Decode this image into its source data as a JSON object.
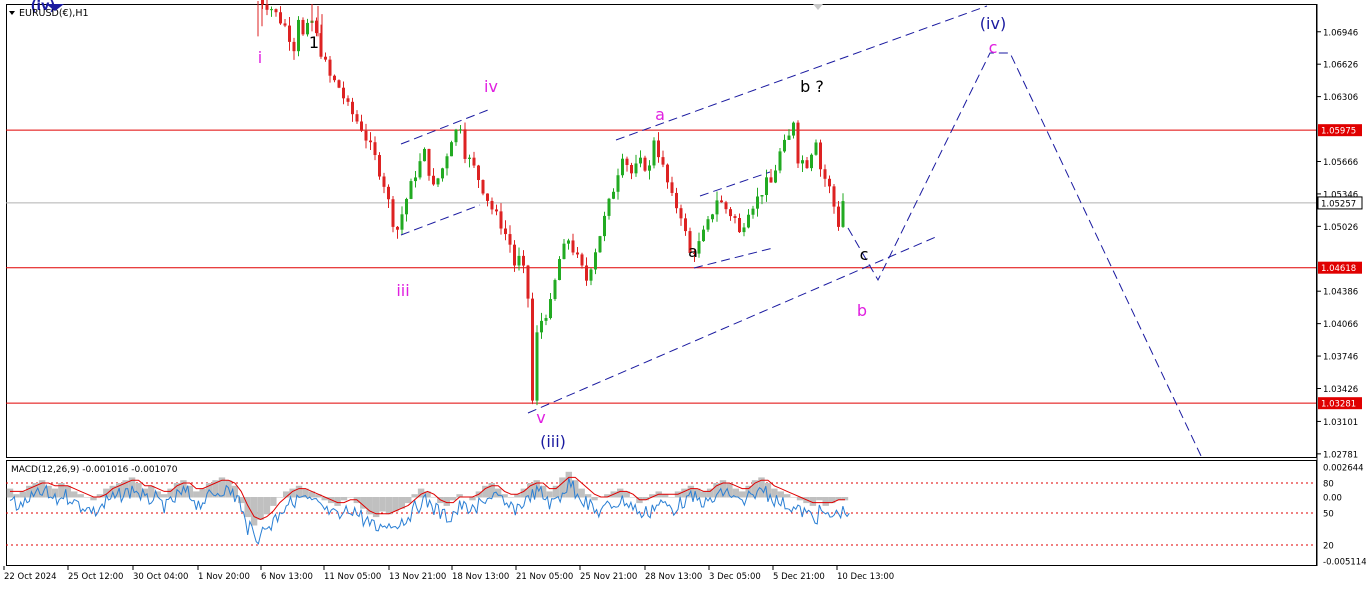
{
  "symbol_label": "EURUSD(€),H1",
  "indicator_label": "MACD(12,26,9) -0.001016 -0.001070",
  "colors": {
    "bull": "#22aa22",
    "bear": "#dd2222",
    "hline": "#e00000",
    "wave_blue": "#1a1aa0",
    "wave_magenta": "#e020e0",
    "macd_line": "#2a7fd4",
    "signal_line": "#e00000",
    "histogram": "#c0c0c0",
    "current_price_tag": "#ffffff"
  },
  "chart_data": [
    {
      "type": "candlestick",
      "title": "EURUSD(€),H1",
      "ylim": [
        1.0275,
        1.0722
      ],
      "y_ticks": [
        "1.06946",
        "1.06626",
        "1.06306",
        "1.05666",
        "1.05346",
        "1.05026",
        "1.04386",
        "1.04066",
        "1.03746",
        "1.03426",
        "1.03101",
        "1.02781"
      ],
      "x_ticks": [
        "22 Oct 2024",
        "25 Oct 12:00",
        "30 Oct 04:00",
        "1 Nov 20:00",
        "6 Nov 13:00",
        "11 Nov 05:00",
        "13 Nov 21:00",
        "18 Nov 13:00",
        "21 Nov 05:00",
        "25 Nov 21:00",
        "28 Nov 13:00",
        "3 Dec 05:00",
        "5 Dec 21:00",
        "10 Dec 13:00"
      ],
      "horizontal_levels": [
        {
          "label": "1.05975",
          "value": 1.05975
        },
        {
          "label": "1.04618",
          "value": 1.04618
        },
        {
          "label": "1.03281",
          "value": 1.03281
        }
      ],
      "current_price": {
        "label": "1.05257",
        "value": 1.05257
      },
      "price_path": [
        [
          0,
          1.0728
        ],
        [
          3,
          1.0718
        ],
        [
          6,
          1.07
        ],
        [
          8,
          1.068
        ],
        [
          9,
          1.071
        ],
        [
          10,
          1.069
        ],
        [
          12,
          1.0705
        ],
        [
          14,
          1.0675
        ],
        [
          16,
          1.065
        ],
        [
          18,
          1.064
        ],
        [
          20,
          1.062
        ],
        [
          23,
          1.06
        ],
        [
          26,
          1.057
        ],
        [
          28,
          1.0545
        ],
        [
          30,
          1.0508
        ],
        [
          31,
          1.05
        ],
        [
          33,
          1.053
        ],
        [
          35,
          1.0555
        ],
        [
          37,
          1.0575
        ],
        [
          39,
          1.054
        ],
        [
          41,
          1.056
        ],
        [
          43,
          1.059
        ],
        [
          45,
          1.0603
        ],
        [
          46,
          1.0575
        ],
        [
          48,
          1.056
        ],
        [
          50,
          1.054
        ],
        [
          52,
          1.052
        ],
        [
          54,
          1.0505
        ],
        [
          56,
          1.0485
        ],
        [
          57,
          1.0465
        ],
        [
          58,
          1.047
        ],
        [
          59,
          1.0458
        ],
        [
          60,
          1.0432
        ],
        [
          61,
          1.033
        ],
        [
          62,
          1.0395
        ],
        [
          63,
          1.041
        ],
        [
          65,
          1.0425
        ],
        [
          67,
          1.047
        ],
        [
          69,
          1.049
        ],
        [
          71,
          1.047
        ],
        [
          73,
          1.045
        ],
        [
          75,
          1.048
        ],
        [
          77,
          1.051
        ],
        [
          79,
          1.054
        ],
        [
          81,
          1.0575
        ],
        [
          83,
          1.0555
        ],
        [
          85,
          1.0565
        ],
        [
          87,
          1.056
        ],
        [
          88,
          1.059
        ],
        [
          90,
          1.056
        ],
        [
          92,
          1.053
        ],
        [
          94,
          1.0515
        ],
        [
          96,
          1.0475
        ],
        [
          98,
          1.0485
        ],
        [
          100,
          1.0505
        ],
        [
          102,
          1.053
        ],
        [
          104,
          1.052
        ],
        [
          106,
          1.051
        ],
        [
          107,
          1.0495
        ],
        [
          109,
          1.052
        ],
        [
          111,
          1.053
        ],
        [
          113,
          1.0545
        ],
        [
          114,
          1.0545
        ],
        [
          116,
          1.0575
        ],
        [
          118,
          1.059
        ],
        [
          119,
          1.0608
        ],
        [
          120,
          1.057
        ],
        [
          122,
          1.0565
        ],
        [
          124,
          1.059
        ],
        [
          125,
          1.056
        ],
        [
          127,
          1.054
        ],
        [
          129,
          1.0505
        ],
        [
          130,
          1.0528
        ]
      ],
      "wave_labels": [
        {
          "text": "(iv)",
          "color": "blue"
        },
        {
          "text": "i",
          "color": "magenta"
        },
        {
          "text": "1",
          "color": "black"
        },
        {
          "text": "iv",
          "color": "magenta"
        },
        {
          "text": "iii",
          "color": "magenta"
        },
        {
          "text": "a",
          "color": "magenta"
        },
        {
          "text": "a",
          "color": "black"
        },
        {
          "text": "b ?",
          "color": "black"
        },
        {
          "text": "c",
          "color": "black"
        },
        {
          "text": "b",
          "color": "magenta"
        },
        {
          "text": "c",
          "color": "magenta"
        },
        {
          "text": "(iv)",
          "color": "blue"
        },
        {
          "text": "v",
          "color": "magenta"
        },
        {
          "text": "(iii)",
          "color": "blue"
        }
      ]
    },
    {
      "type": "line",
      "title": "MACD(12,26,9) -0.001016 -0.001070",
      "y_ticks": [
        "0.002644",
        "80",
        "0.00",
        "50",
        "20",
        "-0.005114"
      ],
      "series": [
        {
          "name": "MACD",
          "values": [
            0.3,
            0.1,
            0.2,
            0.4,
            0.5,
            0.6,
            0.4,
            0.3,
            0.5,
            0.4,
            0.2,
            0.1,
            0.0,
            -0.1,
            0.1,
            0.3,
            0.4,
            0.5,
            0.6,
            0.7,
            0.5,
            0.3,
            0.4,
            0.2,
            0.1,
            0.3,
            0.5,
            0.6,
            0.4,
            0.2,
            0.3,
            0.5,
            0.6,
            0.7,
            0.6,
            0.4,
            -0.2,
            -0.7,
            -1.0,
            -0.8,
            -0.6,
            -0.3,
            0.0,
            0.2,
            0.3,
            0.4,
            0.3,
            0.2,
            0.1,
            -0.1,
            -0.2,
            -0.3,
            -0.1,
            0.0,
            -0.2,
            -0.4,
            -0.6,
            -0.7,
            -0.5,
            -0.6,
            -0.5,
            -0.4,
            -0.2,
            0.1,
            0.3,
            0.2,
            0.0,
            -0.2,
            -0.3,
            -0.1,
            0.1,
            0.0,
            -0.1,
            0.2,
            0.4,
            0.5,
            0.3,
            0.1,
            0.0,
            0.1,
            0.3,
            0.5,
            0.6,
            0.4,
            0.2,
            0.4,
            0.7,
            0.9,
            0.6,
            0.3,
            0.1,
            -0.1,
            0.0,
            0.1,
            0.2,
            0.3,
            0.2,
            0.0,
            -0.2,
            -0.1,
            0.1,
            0.2,
            0.1,
            0.0,
            0.2,
            0.3,
            0.4,
            0.3,
            0.2,
            0.3,
            0.5,
            0.6,
            0.5,
            0.3,
            0.2,
            0.4,
            0.6,
            0.7,
            0.5,
            0.3,
            0.2,
            0.1,
            0.0,
            -0.1,
            -0.2,
            -0.3,
            -0.1,
            -0.3,
            -0.2,
            -0.1,
            -0.1
          ]
        },
        {
          "name": "Signal",
          "values": [
            0.2,
            0.2,
            0.2,
            0.3,
            0.4,
            0.5,
            0.5,
            0.4,
            0.4,
            0.4,
            0.3,
            0.2,
            0.1,
            0.0,
            0.0,
            0.1,
            0.3,
            0.4,
            0.5,
            0.6,
            0.6,
            0.4,
            0.4,
            0.3,
            0.2,
            0.2,
            0.4,
            0.5,
            0.5,
            0.3,
            0.3,
            0.4,
            0.5,
            0.6,
            0.6,
            0.5,
            0.2,
            -0.3,
            -0.7,
            -0.8,
            -0.7,
            -0.5,
            -0.2,
            0.0,
            0.2,
            0.3,
            0.3,
            0.2,
            0.1,
            0.0,
            -0.1,
            -0.2,
            -0.2,
            -0.1,
            -0.1,
            -0.3,
            -0.5,
            -0.6,
            -0.6,
            -0.6,
            -0.5,
            -0.4,
            -0.3,
            -0.1,
            0.1,
            0.2,
            0.1,
            -0.1,
            -0.2,
            -0.2,
            0.0,
            0.0,
            0.0,
            0.1,
            0.3,
            0.4,
            0.4,
            0.2,
            0.1,
            0.1,
            0.2,
            0.4,
            0.5,
            0.5,
            0.3,
            0.3,
            0.5,
            0.7,
            0.7,
            0.5,
            0.3,
            0.1,
            0.0,
            0.0,
            0.1,
            0.2,
            0.2,
            0.1,
            -0.1,
            -0.1,
            0.0,
            0.1,
            0.1,
            0.1,
            0.1,
            0.2,
            0.3,
            0.3,
            0.2,
            0.2,
            0.4,
            0.5,
            0.5,
            0.4,
            0.3,
            0.3,
            0.5,
            0.6,
            0.6,
            0.4,
            0.3,
            0.2,
            0.1,
            0.0,
            -0.1,
            -0.2,
            -0.2,
            -0.2,
            -0.2,
            -0.1,
            -0.1
          ]
        }
      ]
    }
  ]
}
